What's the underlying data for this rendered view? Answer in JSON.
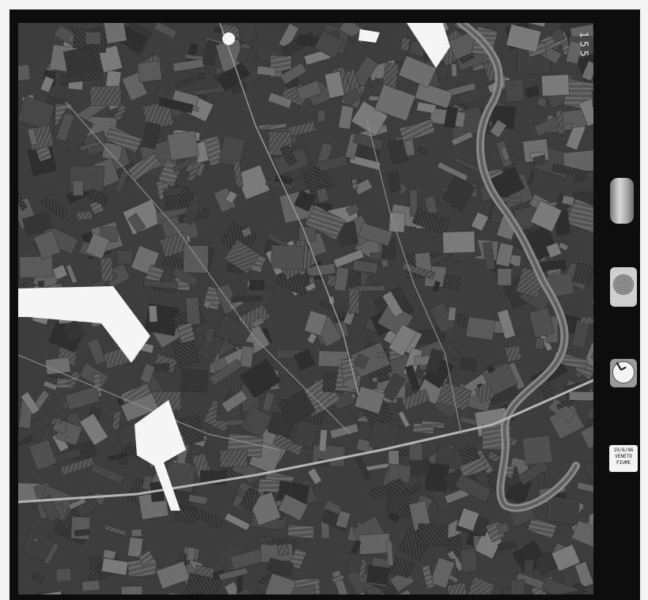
{
  "photo": {
    "frame_number": "155",
    "data_label_lines": [
      "19/6/86",
      "VENETO",
      "FIUME"
    ],
    "colors": {
      "film_border": "#0d0d0d",
      "outer_margin": "#f4f4f4",
      "terrain_base": "#3d3d3d",
      "river": "#8a8a8a",
      "road": "#b5b5b5",
      "masked_blank": "#f5f5f5"
    }
  },
  "instruments": {
    "level_gauge_icon": "bubble-level-icon",
    "altimeter_icon": "altimeter-icon",
    "clock_icon": "clock-icon"
  }
}
